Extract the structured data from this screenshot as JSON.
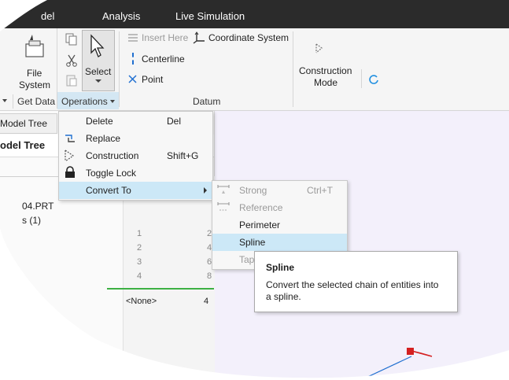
{
  "menubar": {
    "items": [
      "del",
      "Analysis",
      "Live Simulation"
    ]
  },
  "ribbon": {
    "file_system": {
      "line1": "File",
      "line2": "System"
    },
    "select_label": "Select",
    "insert_here": "Insert Here",
    "coordinate_system": "Coordinate System",
    "centerline": "Centerline",
    "point": "Point",
    "construction_mode": {
      "line1": "Construction",
      "line2": "Mode"
    },
    "groups": {
      "get_data": "Get Data",
      "operations": "Operations",
      "datum": "Datum"
    }
  },
  "tree": {
    "tab_label": "Model Tree",
    "header": "odel Tree",
    "part_name": "04.PRT",
    "sub_item": "s (1)",
    "row_numbers": [
      "1",
      "2",
      "3",
      "4"
    ],
    "right_numbers": [
      "2",
      "4",
      "6",
      "8"
    ],
    "none_label": "<None>",
    "none_value": "4"
  },
  "operations_menu": {
    "items": [
      {
        "label": "Delete",
        "shortcut": "Del"
      },
      {
        "label": "Replace",
        "shortcut": ""
      },
      {
        "label": "Construction",
        "shortcut": "Shift+G"
      },
      {
        "label": "Toggle Lock",
        "shortcut": ""
      },
      {
        "label": "Convert To",
        "shortcut": ""
      }
    ]
  },
  "convert_menu": {
    "items": [
      {
        "label": "Strong",
        "shortcut": "Ctrl+T"
      },
      {
        "label": "Reference",
        "shortcut": ""
      },
      {
        "label": "Perimeter",
        "shortcut": ""
      },
      {
        "label": "Spline",
        "shortcut": ""
      },
      {
        "label": "Tape",
        "shortcut": ""
      }
    ]
  },
  "tooltip": {
    "title": "Spline",
    "body_line1": "Convert the selected chain of entities into",
    "body_line2": "a spline."
  },
  "colors": {
    "menubar": "#2b2b2b",
    "highlight": "#cce8f7",
    "canvas": "#f3f0fb",
    "green_line": "#3cb043",
    "sketch_red": "#d42020",
    "sketch_blue": "#1f6fd0"
  }
}
